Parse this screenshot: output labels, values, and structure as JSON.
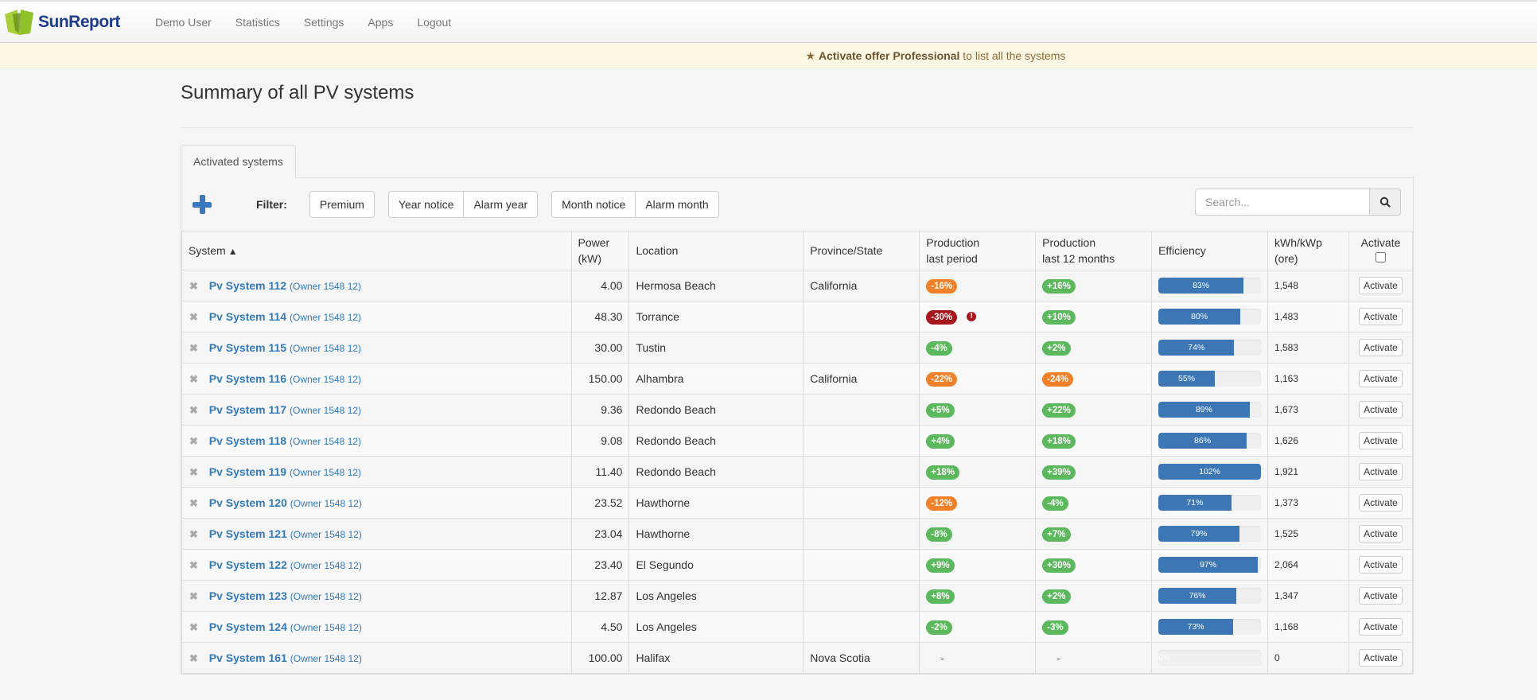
{
  "brand": {
    "name": "SunReport"
  },
  "nav": {
    "items": [
      "Demo User",
      "Statistics",
      "Settings",
      "Apps",
      "Logout"
    ]
  },
  "offer": {
    "icon": "star-icon",
    "bold": "Activate offer Professional",
    "rest": " to list all the systems"
  },
  "page": {
    "title": "Summary of all PV systems"
  },
  "tabs": [
    {
      "label": "Activated systems",
      "active": true
    }
  ],
  "toolbar": {
    "add_icon": "plus-icon",
    "filter_label": "Filter:",
    "groups": [
      [
        "Premium"
      ],
      [
        "Year notice",
        "Alarm year"
      ],
      [
        "Month notice",
        "Alarm month"
      ]
    ],
    "search_placeholder": "Search...",
    "search_value": ""
  },
  "colors": {
    "link": "#337ab7",
    "badge_green": "#5cb85c",
    "badge_orange": "#f0802a",
    "badge_red": "#a6161c",
    "bar_blue": "#3c76b4"
  },
  "table": {
    "headers": {
      "system": "System",
      "power_l1": "Power",
      "power_l2": "(kW)",
      "location": "Location",
      "province": "Province/State",
      "prod_last_l1": "Production",
      "prod_last_l2": "last period",
      "prod_12_l1": "Production",
      "prod_12_l2": "last 12 months",
      "efficiency": "Efficiency",
      "kwh_l1": "kWh/kWp",
      "kwh_l2": "(ore)",
      "activate": "Activate"
    },
    "activate_all_checked": false,
    "rows": [
      {
        "name": "Pv System 112",
        "owner": "(Owner 1548 12)",
        "power": "4.00",
        "location": "Hermosa Beach",
        "province": "California",
        "prod_last": {
          "text": "-16%",
          "status": "orange"
        },
        "prod_12": {
          "text": "+16%",
          "status": "green"
        },
        "efficiency": 83,
        "kwh": "1,548",
        "alert": false,
        "action": "Activate"
      },
      {
        "name": "Pv System 114",
        "owner": "(Owner 1548 12)",
        "power": "48.30",
        "location": "Torrance",
        "province": "",
        "prod_last": {
          "text": "-30%",
          "status": "red"
        },
        "prod_12": {
          "text": "+10%",
          "status": "green"
        },
        "efficiency": 80,
        "kwh": "1,483",
        "alert": true,
        "action": "Activate"
      },
      {
        "name": "Pv System 115",
        "owner": "(Owner 1548 12)",
        "power": "30.00",
        "location": "Tustin",
        "province": "",
        "prod_last": {
          "text": "-4%",
          "status": "green"
        },
        "prod_12": {
          "text": "+2%",
          "status": "green"
        },
        "efficiency": 74,
        "kwh": "1,583",
        "alert": false,
        "action": "Activate"
      },
      {
        "name": "Pv System 116",
        "owner": "(Owner 1548 12)",
        "power": "150.00",
        "location": "Alhambra",
        "province": "California",
        "prod_last": {
          "text": "-22%",
          "status": "orange"
        },
        "prod_12": {
          "text": "-24%",
          "status": "orange"
        },
        "efficiency": 55,
        "kwh": "1,163",
        "alert": false,
        "action": "Activate"
      },
      {
        "name": "Pv System 117",
        "owner": "(Owner 1548 12)",
        "power": "9.36",
        "location": "Redondo Beach",
        "province": "",
        "prod_last": {
          "text": "+5%",
          "status": "green"
        },
        "prod_12": {
          "text": "+22%",
          "status": "green"
        },
        "efficiency": 89,
        "kwh": "1,673",
        "alert": false,
        "action": "Activate"
      },
      {
        "name": "Pv System 118",
        "owner": "(Owner 1548 12)",
        "power": "9.08",
        "location": "Redondo Beach",
        "province": "",
        "prod_last": {
          "text": "+4%",
          "status": "green"
        },
        "prod_12": {
          "text": "+18%",
          "status": "green"
        },
        "efficiency": 86,
        "kwh": "1,626",
        "alert": false,
        "action": "Activate"
      },
      {
        "name": "Pv System 119",
        "owner": "(Owner 1548 12)",
        "power": "11.40",
        "location": "Redondo Beach",
        "province": "",
        "prod_last": {
          "text": "+18%",
          "status": "green"
        },
        "prod_12": {
          "text": "+39%",
          "status": "green"
        },
        "efficiency": 102,
        "kwh": "1,921",
        "alert": false,
        "action": "Activate"
      },
      {
        "name": "Pv System 120",
        "owner": "(Owner 1548 12)",
        "power": "23.52",
        "location": "Hawthorne",
        "province": "",
        "prod_last": {
          "text": "-12%",
          "status": "orange"
        },
        "prod_12": {
          "text": "-4%",
          "status": "green"
        },
        "efficiency": 71,
        "kwh": "1,373",
        "alert": false,
        "action": "Activate"
      },
      {
        "name": "Pv System 121",
        "owner": "(Owner 1548 12)",
        "power": "23.04",
        "location": "Hawthorne",
        "province": "",
        "prod_last": {
          "text": "-8%",
          "status": "green"
        },
        "prod_12": {
          "text": "+7%",
          "status": "green"
        },
        "efficiency": 79,
        "kwh": "1,525",
        "alert": false,
        "action": "Activate"
      },
      {
        "name": "Pv System 122",
        "owner": "(Owner 1548 12)",
        "power": "23.40",
        "location": "El Segundo",
        "province": "",
        "prod_last": {
          "text": "+9%",
          "status": "green"
        },
        "prod_12": {
          "text": "+30%",
          "status": "green"
        },
        "efficiency": 97,
        "kwh": "2,064",
        "alert": false,
        "action": "Activate"
      },
      {
        "name": "Pv System 123",
        "owner": "(Owner 1548 12)",
        "power": "12.87",
        "location": "Los Angeles",
        "province": "",
        "prod_last": {
          "text": "+8%",
          "status": "green"
        },
        "prod_12": {
          "text": "+2%",
          "status": "green"
        },
        "efficiency": 76,
        "kwh": "1,347",
        "alert": false,
        "action": "Activate"
      },
      {
        "name": "Pv System 124",
        "owner": "(Owner 1548 12)",
        "power": "4.50",
        "location": "Los Angeles",
        "province": "",
        "prod_last": {
          "text": "-2%",
          "status": "green"
        },
        "prod_12": {
          "text": "-3%",
          "status": "green"
        },
        "efficiency": 73,
        "kwh": "1,168",
        "alert": false,
        "action": "Activate"
      },
      {
        "name": "Pv System 161",
        "owner": "(Owner 1548 12)",
        "power": "100.00",
        "location": "Halifax",
        "province": "Nova Scotia",
        "prod_last": {
          "text": "-",
          "status": "none"
        },
        "prod_12": {
          "text": "-",
          "status": "none"
        },
        "efficiency": 0,
        "kwh": "0",
        "alert": false,
        "action": "Activate"
      }
    ]
  }
}
